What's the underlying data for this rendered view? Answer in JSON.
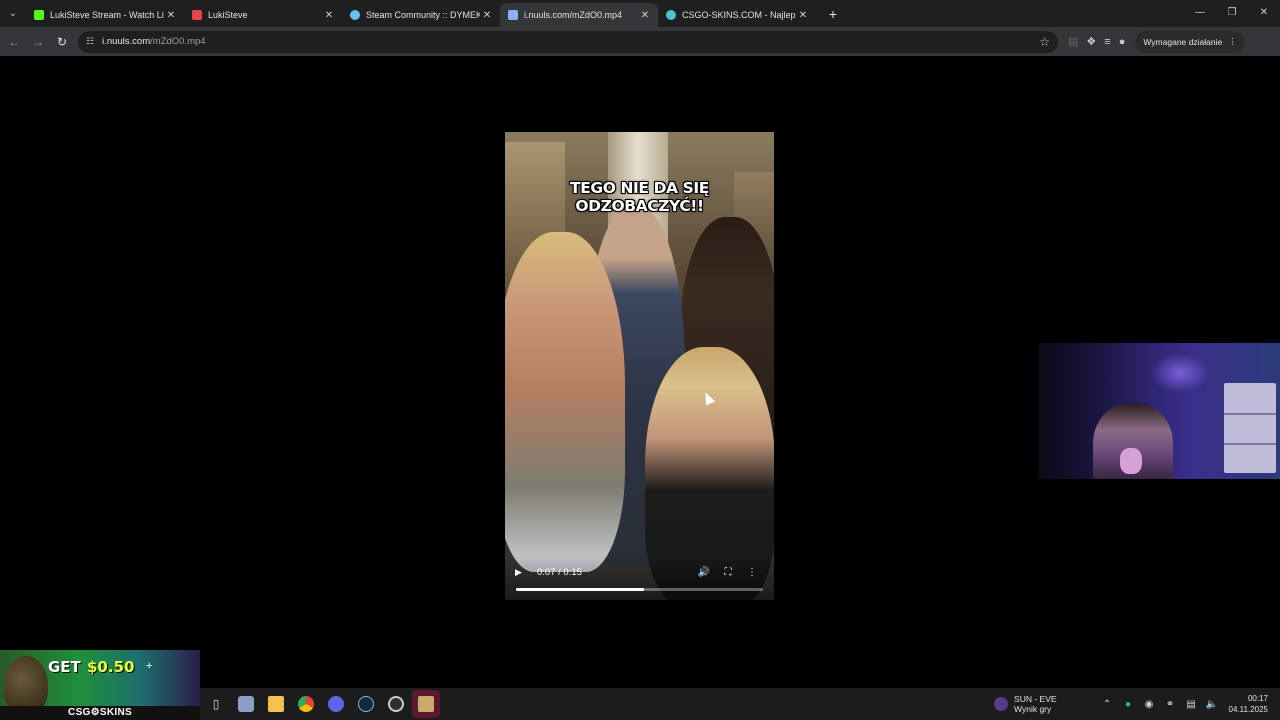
{
  "browser": {
    "tabs": [
      {
        "title": "LukiSteve Stream - Watch Live o",
        "favicon_color": "#53fc18",
        "active": false
      },
      {
        "title": "LukiSteve",
        "favicon_color": "#e8444a",
        "active": false
      },
      {
        "title": "Steam Community :: DYMEK",
        "favicon_color": "#66c0f4",
        "active": false
      },
      {
        "title": "i.nuuls.com/mZdO0.mp4",
        "favicon_color": "#8ab4f8",
        "active": true
      },
      {
        "title": "CSGO-SKINS.COM - Najlepsze",
        "favicon_color": "#4ec1d6",
        "active": false
      }
    ],
    "address": {
      "host": "i.nuuls.com",
      "path": "/mZdO0.mp4"
    },
    "action_button": "Wymagane działanie"
  },
  "video": {
    "caption": "TEGO NIE DA SIĘ ODZOBACZYĆ!!",
    "time": "0:07 / 0:15",
    "progress": 0.52
  },
  "ad": {
    "get_label": "GET",
    "amount": "$0.50",
    "brand": "CSG⚙SKINS"
  },
  "taskbar": {
    "game_title": "SUN - EVE",
    "game_subtitle": "Wynik gry",
    "time": "00:17",
    "date": "04.11.2025"
  }
}
